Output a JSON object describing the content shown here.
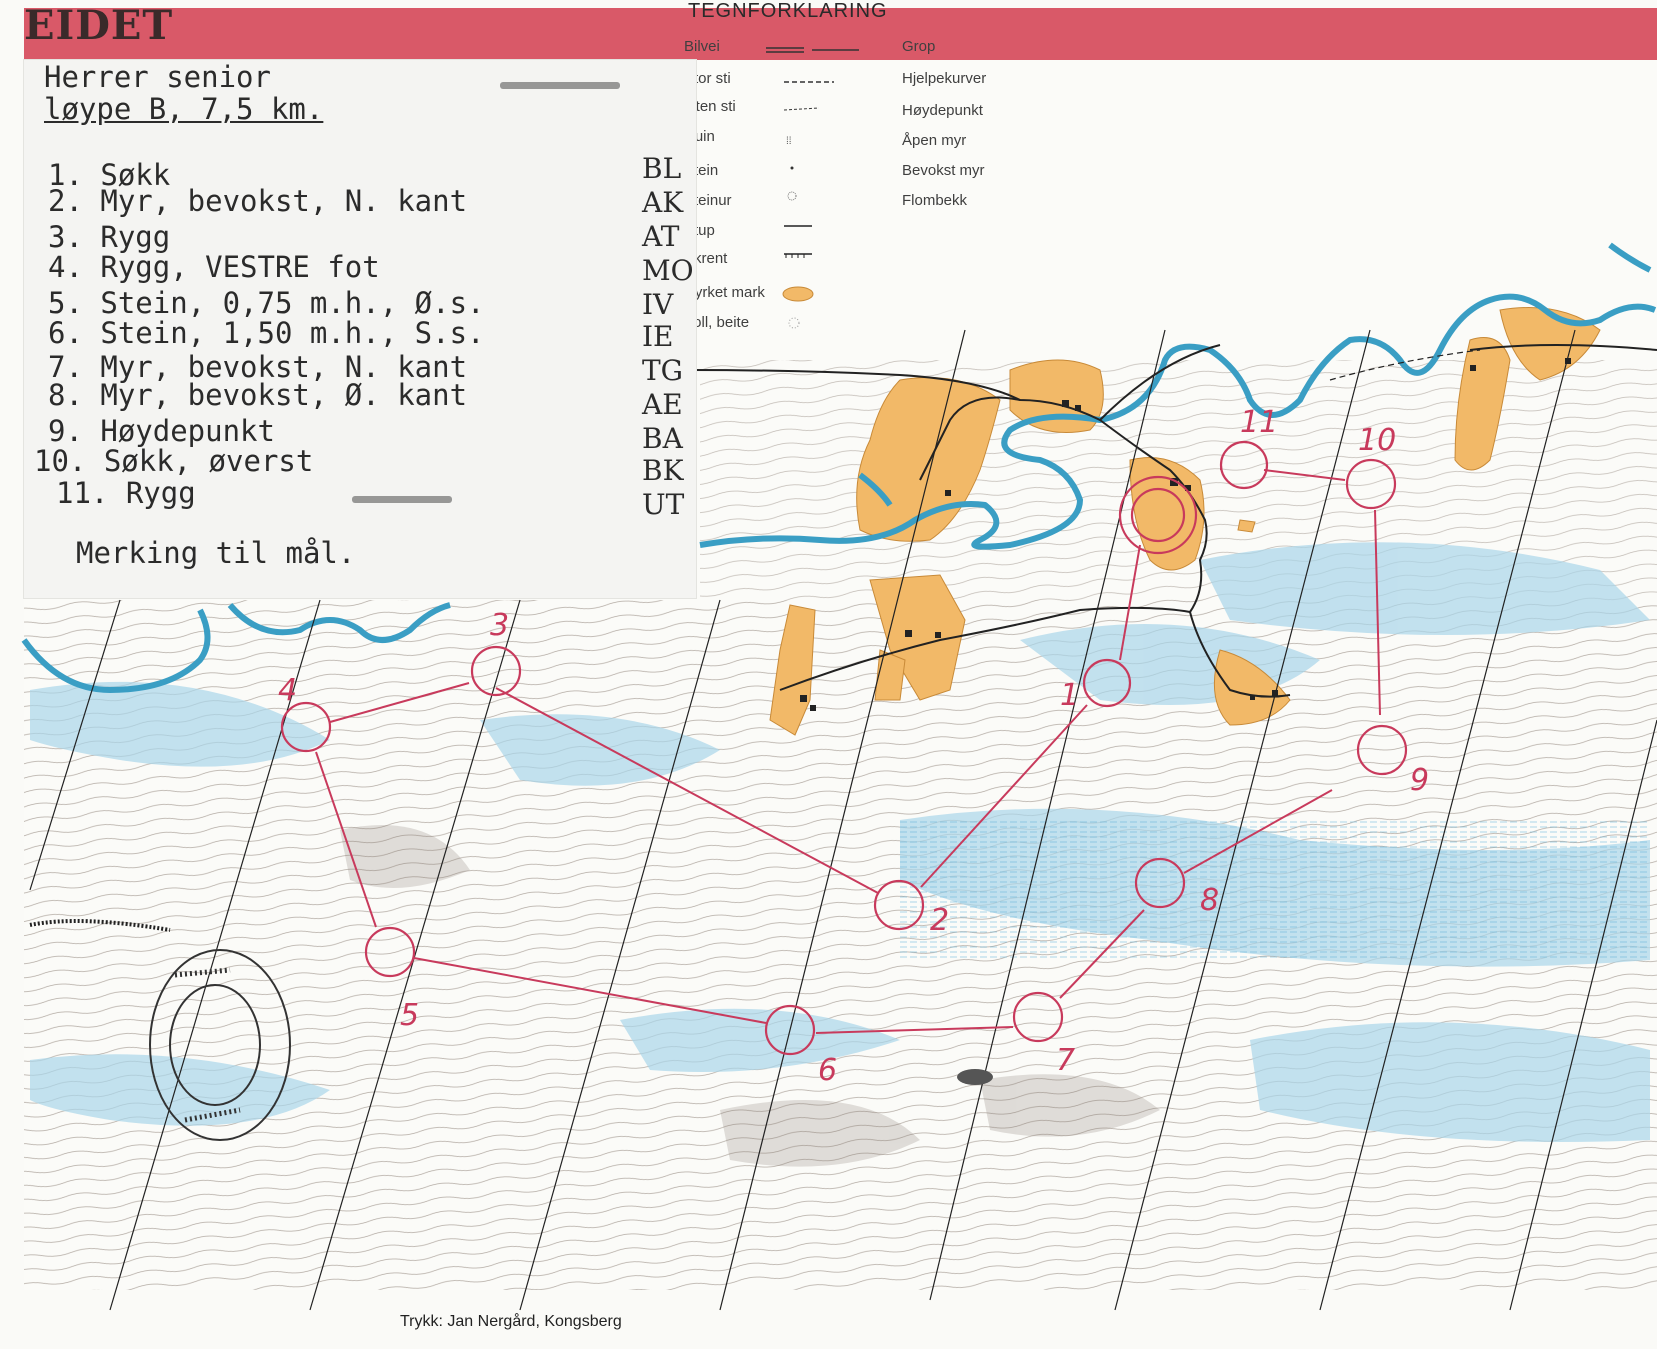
{
  "header": {
    "title": "EIDET"
  },
  "legend": {
    "title": "TEGNFORKLARING",
    "left_items": [
      "Bilvei",
      "Stor sti",
      "Liten sti",
      "Ruin",
      "Stein",
      "Steinur",
      "Stup",
      "Skrent",
      "Dyrket mark",
      "Voll, beite"
    ],
    "right_items": [
      "Grop",
      "Hjelpekurver",
      "Høydepunkt",
      "Åpen myr",
      "Bevokst myr",
      "Flombekk"
    ]
  },
  "description_card": {
    "class": "Herrer senior",
    "course": "løype B, 7,5 km.",
    "controls": [
      {
        "text": "1. Søkk",
        "code": "BL"
      },
      {
        "text": "2. Myr, bevokst, N. kant",
        "code": "AK"
      },
      {
        "text": "3. Rygg",
        "code": "AT"
      },
      {
        "text": "4. Rygg, VESTRE fot",
        "code": "MO"
      },
      {
        "text": "5. Stein, 0,75 m.h., Ø.s.",
        "code": "IV"
      },
      {
        "text": "6. Stein, 1,50 m.h., S.s.",
        "code": "IE"
      },
      {
        "text": "7. Myr, bevokst, N. kant",
        "code": "TG"
      },
      {
        "text": "8. Myr, bevokst, Ø. kant",
        "code": "AE"
      },
      {
        "text": "9. Høydepunkt",
        "code": "BA"
      },
      {
        "text": "10. Søkk, øverst",
        "code": "BK"
      },
      {
        "text": "11. Rygg",
        "code": "UT"
      }
    ],
    "finish_note": "Merking til mål."
  },
  "course_labels": [
    "1",
    "2",
    "3",
    "4",
    "5",
    "6",
    "7",
    "8",
    "9",
    "10",
    "11"
  ],
  "footer": {
    "credit": "Trykk: Jan Nergård, Kongsberg"
  },
  "colors": {
    "course": "#c83a5c",
    "water": "#3a9ec4",
    "field": "#f2b968",
    "marsh": "#a9d6ea",
    "header": "#d95968"
  }
}
